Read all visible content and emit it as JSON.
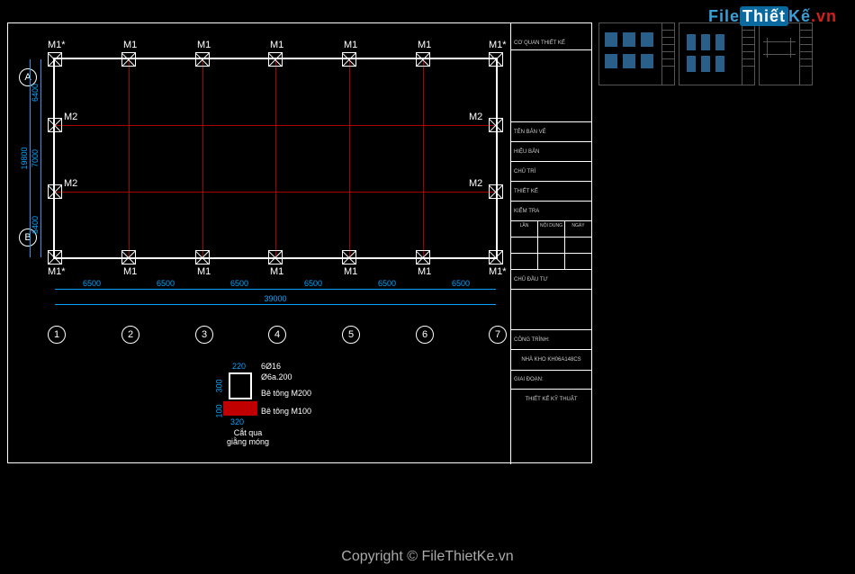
{
  "watermark": {
    "p1": "File",
    "p2": "Thiết",
    "p3": "Kế",
    "p4": ".vn"
  },
  "copyright": "Copyright © FileThietKe.vn",
  "plan": {
    "cols": 7,
    "col_spacing": 6500,
    "total_length": 39000,
    "row_spacings": [
      6400,
      7000,
      6400
    ],
    "total_height": 19800,
    "axis_letters": [
      "A",
      "B"
    ],
    "axis_numbers": [
      "1",
      "2",
      "3",
      "4",
      "5",
      "6",
      "7"
    ],
    "top_labels": [
      "M1*",
      "M1",
      "M1",
      "M1",
      "M1",
      "M1",
      "M1*"
    ],
    "bot_labels": [
      "M1*",
      "M1",
      "M1",
      "M1",
      "M1",
      "M1",
      "M1*"
    ],
    "inner_labels": {
      "left": "M2",
      "right": "M2"
    },
    "dim_labels": [
      "6500",
      "6500",
      "6500",
      "6500",
      "6500",
      "6500"
    ],
    "dim_total": "39000",
    "v_dims": [
      "6400",
      "7000",
      "6400"
    ],
    "v_total": "19800"
  },
  "section": {
    "title": "Cắt qua\ngiằng móng",
    "w_top": "220",
    "h_top": "300",
    "w_bot": "320",
    "h_bot": "100",
    "rebar1": "6Ø16",
    "rebar2": "Ø6a.200",
    "conc1": "Bê tông M200",
    "conc2": "Bê tông M100"
  },
  "titleblock": {
    "owner": "CƠ QUAN THIẾT KẾ",
    "t1": "TÊN BẢN VẼ",
    "t2": "HIỆU BẢN",
    "t3": "CHỦ TRÌ",
    "t4": "THIẾT KẾ",
    "t5": "KIỂM TRA",
    "cols": [
      "LẦN",
      "NỘI DUNG",
      "NGÀY"
    ],
    "t6": "CHỦ ĐẦU TƯ",
    "t7": "CÔNG TRÌNH:",
    "proj": "NHÀ KHO KH06A148CS",
    "t8": "GIAI ĐOẠN:",
    "stage": "THIẾT KẾ KỸ THUẬT"
  }
}
